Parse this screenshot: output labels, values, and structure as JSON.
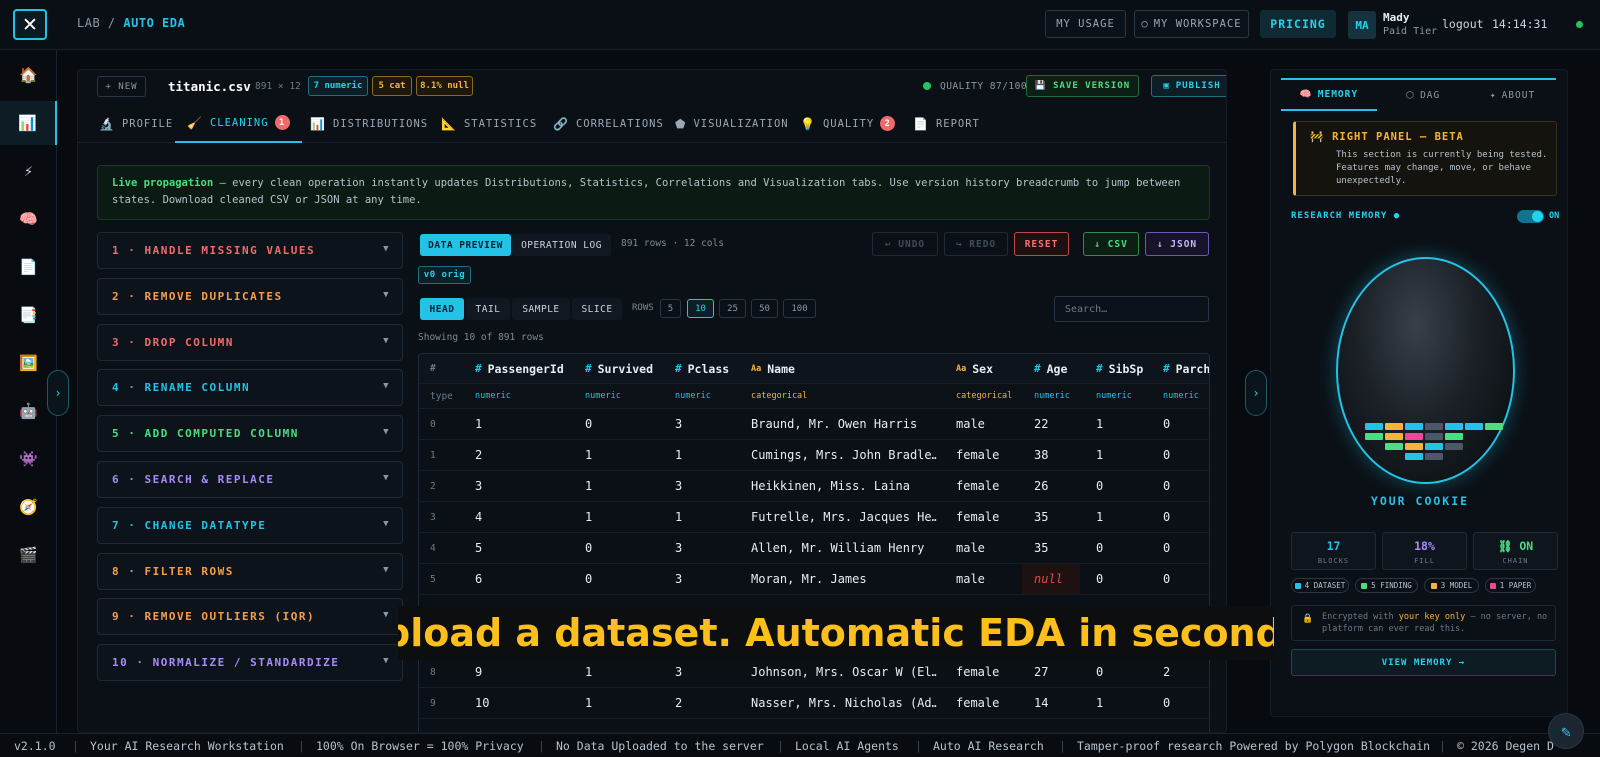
{
  "topbar": {
    "logo_glyph": "✕",
    "crumb_lab": "LAB",
    "crumb_sep": "/",
    "crumb_page": "AUTO EDA",
    "my_usage": "MY USAGE",
    "my_workspace": "MY WORKSPACE",
    "pricing": "PRICING",
    "avatar_initials": "MA",
    "user_name": "Mady",
    "user_tier": "Paid Tier",
    "logout": "logout",
    "clock": "14:14:31"
  },
  "sidebar": {
    "icons": [
      "🏠",
      "📊",
      "⚡",
      "🧠",
      "📄",
      "📑",
      "🖼️",
      "🤖",
      "👾",
      "🧭",
      "🎬"
    ]
  },
  "filebar": {
    "new_label": "+ NEW",
    "file_name": "titanic.csv",
    "dims": "891 × 12",
    "chips": [
      "7 numeric",
      "5 cat",
      "8.1% null"
    ],
    "quality": "QUALITY 87/100",
    "save_version": "SAVE VERSION",
    "publish": "PUBLISH"
  },
  "tabs": [
    {
      "icon": "🔬",
      "label": "PROFILE"
    },
    {
      "icon": "🧹",
      "label": "CLEANING",
      "badge": "1"
    },
    {
      "icon": "📊",
      "label": "DISTRIBUTIONS"
    },
    {
      "icon": "📐",
      "label": "STATISTICS"
    },
    {
      "icon": "🔗",
      "label": "CORRELATIONS"
    },
    {
      "icon": "⬟",
      "label": "VISUALIZATION"
    },
    {
      "icon": "💡",
      "label": "QUALITY",
      "badge": "2"
    },
    {
      "icon": "📄",
      "label": "REPORT"
    }
  ],
  "live_notice": {
    "title": "Live propagation",
    "text": " — every clean operation instantly updates Distributions, Statistics, Correlations and Visualization tabs. Use version history breadcrumb to jump between states. Download cleaned CSV or JSON at any time."
  },
  "operations": [
    {
      "label": "1 · HANDLE MISSING VALUES",
      "color": "#f06b6b"
    },
    {
      "label": "2 · REMOVE DUPLICATES",
      "color": "#f59e4b"
    },
    {
      "label": "3 · DROP COLUMN",
      "color": "#f06b6b"
    },
    {
      "label": "4 · RENAME COLUMN",
      "color": "#22c3e6"
    },
    {
      "label": "5 · ADD COMPUTED COLUMN",
      "color": "#4ade80"
    },
    {
      "label": "6 · SEARCH & REPLACE",
      "color": "#a78bfa"
    },
    {
      "label": "7 · CHANGE DATATYPE",
      "color": "#22c3e6"
    },
    {
      "label": "8 · FILTER ROWS",
      "color": "#f59e4b"
    },
    {
      "label": "9 · REMOVE OUTLIERS (IQR)",
      "color": "#f59e4b"
    },
    {
      "label": "10 · NORMALIZE / STANDARDIZE",
      "color": "#a78bfa"
    }
  ],
  "preview": {
    "tab_data": "DATA PREVIEW",
    "tab_log": "OPERATION LOG",
    "meta": "891 rows · 12 cols",
    "undo": "↩ UNDO",
    "redo": "↪ REDO",
    "reset": "RESET",
    "csv": "↓ CSV",
    "json": "↓ JSON",
    "version": "v0 orig",
    "modes": [
      "HEAD",
      "TAIL",
      "SAMPLE",
      "SLICE"
    ],
    "rows_label": "ROWS",
    "rows_options": [
      "5",
      "10",
      "25",
      "50",
      "100"
    ],
    "search_placeholder": "Search…",
    "showing": "Showing 10 of 891 rows"
  },
  "table": {
    "columns": [
      {
        "name": "#",
        "type": "type",
        "kind": "idx"
      },
      {
        "name": "PassengerId",
        "type": "numeric",
        "kind": "num"
      },
      {
        "name": "Survived",
        "type": "numeric",
        "kind": "num"
      },
      {
        "name": "Pclass",
        "type": "numeric",
        "kind": "num"
      },
      {
        "name": "Name",
        "type": "categorical",
        "kind": "cat"
      },
      {
        "name": "Sex",
        "type": "categorical",
        "kind": "cat"
      },
      {
        "name": "Age",
        "type": "numeric",
        "kind": "num"
      },
      {
        "name": "SibSp",
        "type": "numeric",
        "kind": "num"
      },
      {
        "name": "Parch",
        "type": "numeric",
        "kind": "num"
      }
    ],
    "rows": [
      [
        "0",
        "1",
        "0",
        "3",
        "Braund, Mr. Owen Harris",
        "male",
        "22",
        "1",
        "0"
      ],
      [
        "1",
        "2",
        "1",
        "1",
        "Cumings, Mrs. John Bradle…",
        "female",
        "38",
        "1",
        "0"
      ],
      [
        "2",
        "3",
        "1",
        "3",
        "Heikkinen, Miss. Laina",
        "female",
        "26",
        "0",
        "0"
      ],
      [
        "3",
        "4",
        "1",
        "1",
        "Futrelle, Mrs. Jacques He…",
        "female",
        "35",
        "1",
        "0"
      ],
      [
        "4",
        "5",
        "0",
        "3",
        "Allen, Mr. William Henry",
        "male",
        "35",
        "0",
        "0"
      ],
      [
        "5",
        "6",
        "0",
        "3",
        "Moran, Mr. James",
        "male",
        "null",
        "0",
        "0"
      ],
      [
        "8",
        "9",
        "1",
        "3",
        "Johnson, Mrs. Oscar W (El…",
        "female",
        "27",
        "0",
        "2"
      ],
      [
        "9",
        "10",
        "1",
        "2",
        "Nasser, Mrs. Nicholas (Ad…",
        "female",
        "14",
        "1",
        "0"
      ]
    ]
  },
  "right_panel": {
    "tabs": [
      {
        "icon": "🧠",
        "label": "MEMORY"
      },
      {
        "icon": "⬡",
        "label": "DAG"
      },
      {
        "icon": "✦",
        "label": "ABOUT"
      }
    ],
    "beta_title": "RIGHT PANEL — BETA",
    "beta_text": "This section is currently being tested. Features may change, move, or behave unexpectedly.",
    "research_memory": "RESEARCH MEMORY ●",
    "toggle_on": "ON",
    "cookie_label": "YOUR COOKIE",
    "stats": [
      {
        "value": "17",
        "label": "BLOCKS",
        "color": "#22c3e6"
      },
      {
        "value": "18%",
        "label": "FILL",
        "color": "#a78bfa"
      },
      {
        "value": "⛓ ON",
        "label": "CHAIN",
        "color": "#4ade80"
      }
    ],
    "tags": [
      {
        "label": "4 DATASET",
        "color": "#22c3e6"
      },
      {
        "label": "5 FINDING",
        "color": "#4ade80"
      },
      {
        "label": "3 MODEL",
        "color": "#f5b43b"
      },
      {
        "label": "1 PAPER",
        "color": "#ec4899"
      }
    ],
    "enc_prefix": "Encrypted with ",
    "enc_key": "your key only",
    "enc_suffix": " — no server, no platform can ever read this.",
    "view_memory": "VIEW MEMORY →"
  },
  "caption": "Upload a dataset. Automatic EDA in seconds.",
  "footer": {
    "items": [
      "v2.1.0",
      "Your AI Research Workstation",
      "100% On Browser = 100% Privacy",
      "No Data Uploaded to the server",
      "Local AI Agents",
      "Auto AI Research",
      "Tamper-proof research Powered by Polygon Blockchain",
      "© 2026 Degen D"
    ]
  },
  "colors": {
    "accent": "#22c3e6",
    "warning": "#f5b43b",
    "success": "#4ade80",
    "danger": "#ef4444"
  }
}
